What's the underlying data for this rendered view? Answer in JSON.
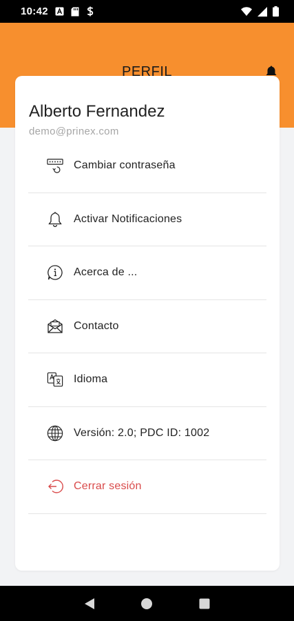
{
  "status_bar": {
    "time": "10:42",
    "icons": [
      "notification-a-icon",
      "sd-card-icon",
      "dollar-icon",
      "wifi-icon",
      "signal-icon",
      "battery-icon"
    ]
  },
  "header": {
    "title": "PERFIL",
    "background": "#f78f2e",
    "action_icon": "bell-icon"
  },
  "profile": {
    "name": "Alberto Fernandez",
    "email": "demo@prinex.com"
  },
  "menu": [
    {
      "label": "Cambiar contraseña",
      "icon": "password-icon"
    },
    {
      "label": "Activar Notificaciones",
      "icon": "bell-outline-icon"
    },
    {
      "label": "Acerca de ...",
      "icon": "info-icon"
    },
    {
      "label": "Contacto",
      "icon": "mail-icon"
    },
    {
      "label": "Idioma",
      "icon": "language-icon"
    },
    {
      "label": "Versión: 2.0; PDC ID: 1002",
      "icon": "globe-icon"
    },
    {
      "label": "Cerrar sesión",
      "icon": "logout-icon",
      "color": "#d94a4a"
    }
  ],
  "nav_bar": {
    "buttons": [
      "back-icon",
      "home-icon",
      "recents-icon"
    ]
  }
}
